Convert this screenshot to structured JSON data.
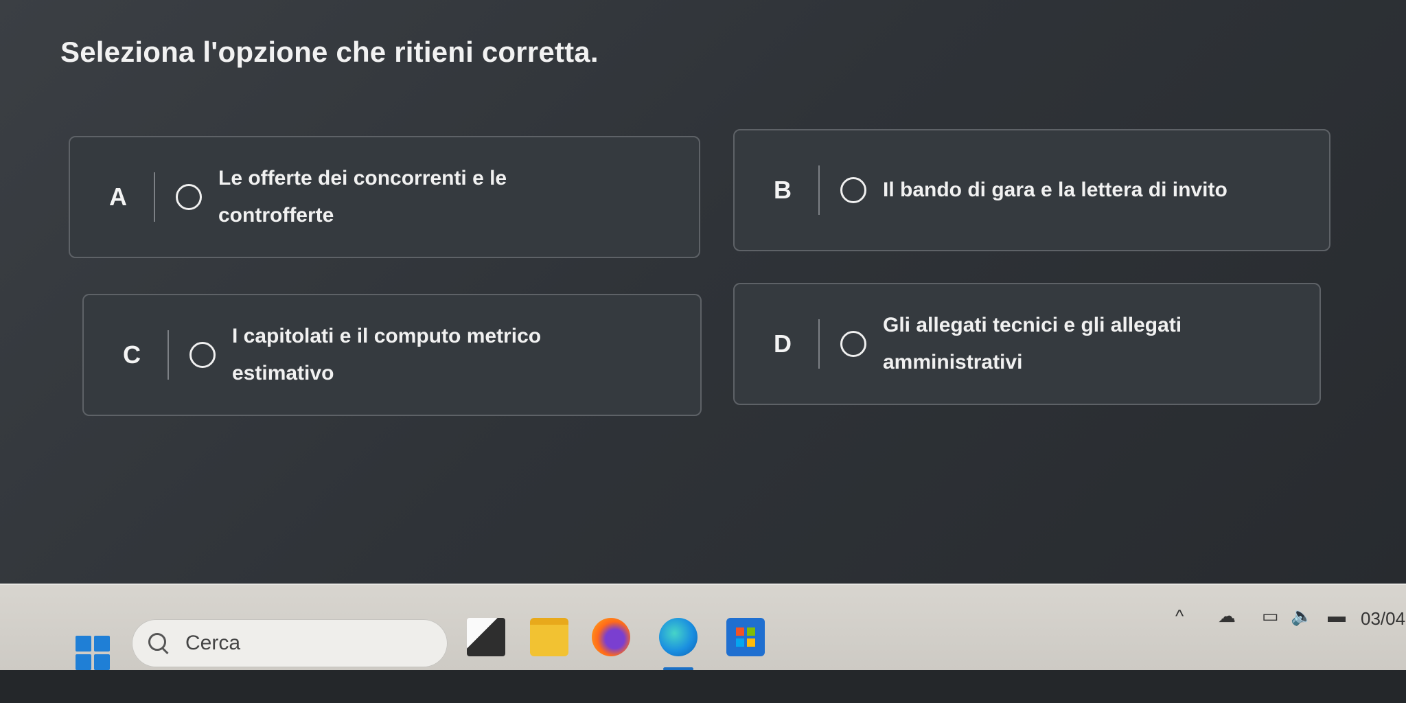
{
  "question": "Seleziona l'opzione che ritieni corretta.",
  "options": [
    {
      "letter": "A",
      "text": "Le offerte dei concorrenti e le controfferte"
    },
    {
      "letter": "B",
      "text": "Il bando di gara e la lettera di invito"
    },
    {
      "letter": "C",
      "text": "I capitolati e il computo metrico estimativo"
    },
    {
      "letter": "D",
      "text": "Gli allegati tecnici e gli allegati amministrativi"
    }
  ],
  "taskbar": {
    "search_placeholder": "Cerca",
    "apps": [
      "task-view-icon",
      "file-explorer-icon",
      "firefox-icon",
      "edge-icon",
      "microsoft-store-icon"
    ],
    "tray": {
      "chevron": "^",
      "date": "03/04"
    }
  },
  "colors": {
    "background": "#2f3338",
    "option_bg": "#353a3f",
    "taskbar": "#d4d1cb",
    "start_blue": "#1f7fd6"
  }
}
